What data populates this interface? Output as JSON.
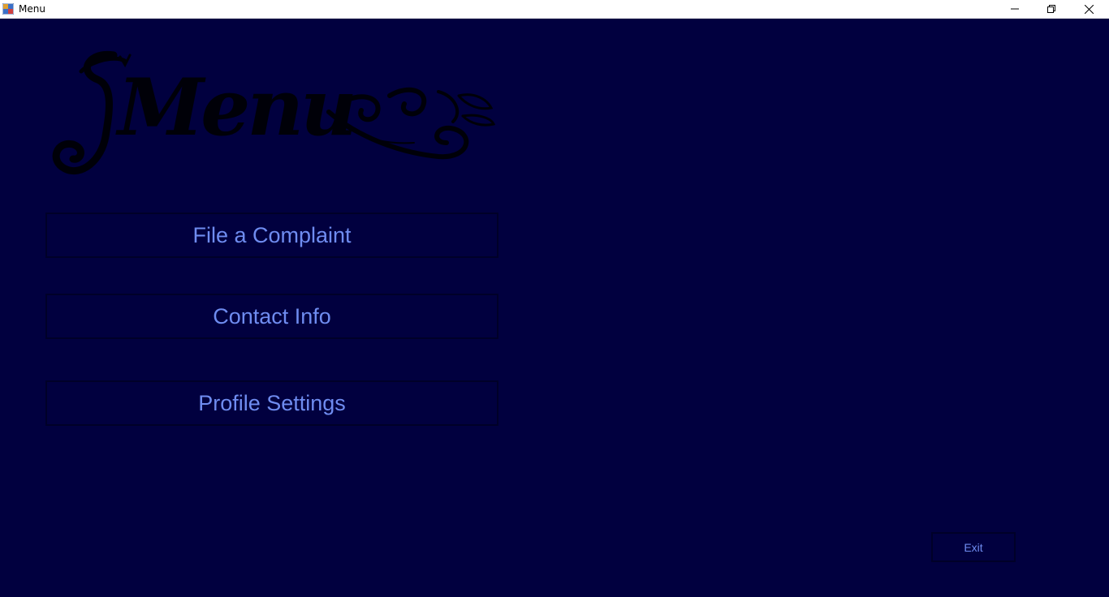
{
  "window": {
    "title": "Menu",
    "controls": {
      "minimize_icon": "minimize-icon",
      "maximize_icon": "restore-icon",
      "close_icon": "close-icon"
    }
  },
  "logo": {
    "text": "Menu",
    "style": "decorative script with swirls"
  },
  "menu": {
    "items": [
      {
        "label": "File a Complaint"
      },
      {
        "label": "Contact Info"
      },
      {
        "label": "Profile Settings"
      }
    ]
  },
  "exit": {
    "label": "Exit"
  },
  "colors": {
    "background": "#01003f",
    "button_text": "#6f8cf0",
    "button_border": "#000028",
    "titlebar": "#ffffff"
  }
}
